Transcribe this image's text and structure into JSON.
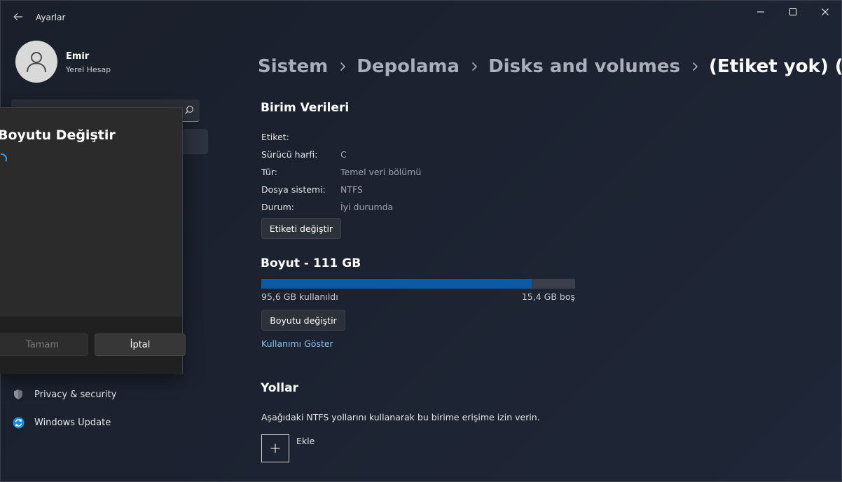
{
  "window": {
    "title": "Ayarlar"
  },
  "profile": {
    "name": "Emir",
    "account": "Yerel Hesap"
  },
  "sidebar": {
    "items": [
      {
        "label": "Privacy & security",
        "icon": "shield-icon"
      },
      {
        "label": "Windows Update",
        "icon": "windows-update-icon"
      }
    ]
  },
  "dialog": {
    "title": "Boyutu Değiştir",
    "ok_label": "Tamam",
    "cancel_label": "İptal"
  },
  "breadcrumb": [
    "Sistem",
    "Depolama",
    "Disks and volumes",
    "(Etiket yok) (C:)"
  ],
  "volume_data": {
    "title": "Birim Verileri",
    "properties": [
      {
        "label": "Etiket:",
        "value": ""
      },
      {
        "label": "Sürücü harfi:",
        "value": "C"
      },
      {
        "label": "Tür:",
        "value": "Temel veri bölümü"
      },
      {
        "label": "Dosya sistemi:",
        "value": "NTFS"
      },
      {
        "label": "Durum:",
        "value": "İyi durumda"
      }
    ],
    "change_label_button": "Etiketi değiştir"
  },
  "size": {
    "title": "Boyut - 111 GB",
    "used_text": "95,6 GB kullanıldı",
    "free_text": "15,4 GB boş",
    "used_fraction": 0.861,
    "resize_button": "Boyutu değiştir",
    "show_usage_link": "Kullanımı Göster"
  },
  "paths": {
    "title": "Yollar",
    "description": "Aşağıdaki NTFS yollarını kullanarak bu birime erişime izin verin.",
    "add_label": "Ekle"
  },
  "colors": {
    "accent": "#0c5aa6",
    "link": "#8cc1ee",
    "background": "#1c2230"
  }
}
